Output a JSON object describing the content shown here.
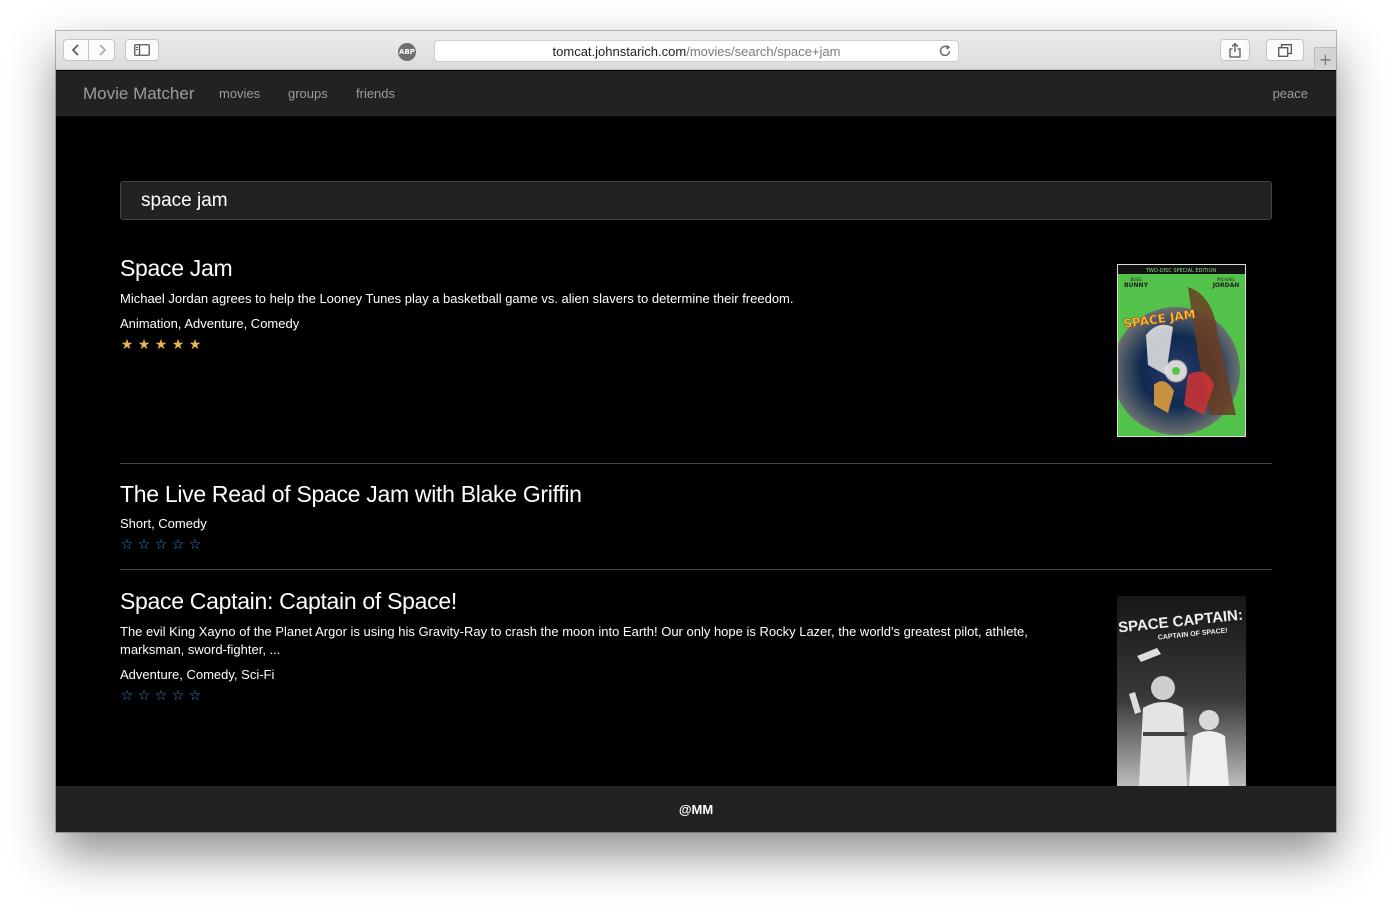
{
  "browser": {
    "url_host": "tomcat.johnstarich.com",
    "url_path": "/movies/search/space+jam",
    "abp_label": "ABP",
    "new_tab_label": "+"
  },
  "navbar": {
    "brand": "Movie Matcher",
    "links": [
      "movies",
      "groups",
      "friends"
    ],
    "right_link": "peace"
  },
  "search": {
    "value": "space jam"
  },
  "results": [
    {
      "title": "Space Jam",
      "description": "Michael Jordan agrees to help the Looney Tunes play a basketball game vs. alien slavers to determine their freedom.",
      "genres": "Animation, Adventure, Comedy",
      "rating": 5,
      "rating_max": 5,
      "poster": {
        "banner": "TWO-DISC SPECIAL EDITION",
        "left_name_top": "BUGS",
        "left_name": "BUNNY",
        "right_name_top": "MICHAEL",
        "right_name": "JORDAN",
        "logo": "SPACE JAM"
      }
    },
    {
      "title": "The Live Read of Space Jam with Blake Griffin",
      "genres": "Short, Comedy",
      "rating": 0,
      "rating_max": 5
    },
    {
      "title": "Space Captain: Captain of Space!",
      "description": "The evil King Xayno of the Planet Argor is using his Gravity-Ray to crash the moon into Earth! Our only hope is Rocky Lazer, the world's greatest pilot, athlete, marksman, sword-fighter, ...",
      "genres": "Adventure, Comedy, Sci-Fi",
      "rating": 0,
      "rating_max": 5,
      "poster": {
        "logo_line1": "SPACE CAPTAIN:",
        "logo_line2": "CAPTAIN OF SPACE!"
      }
    }
  ],
  "stars": {
    "filled": "★",
    "empty": "☆"
  },
  "colors": {
    "star_filled": "#e8b84b",
    "star_empty": "#3a85c6",
    "navbar_bg": "#222222"
  },
  "footer": {
    "text": "@MM"
  }
}
